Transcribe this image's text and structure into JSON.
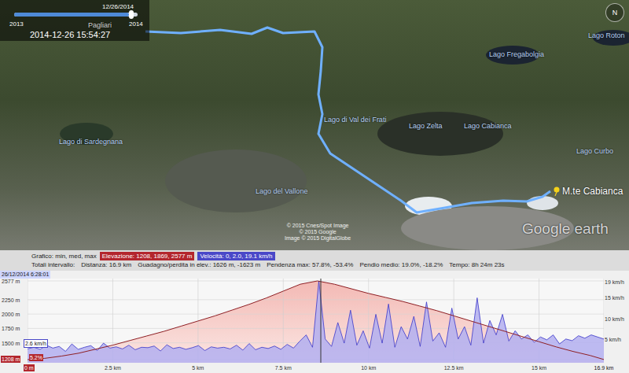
{
  "window": {
    "title": "Google Earth"
  },
  "time_slider": {
    "date": "12/26/2014",
    "start": "2013",
    "end": "2014",
    "level": 0.93,
    "timestamp": "2014-12-26 15:54:27"
  },
  "compass": {
    "label": "N"
  },
  "map": {
    "labels": [
      {
        "text": "Pagliari",
        "kind": "place"
      },
      {
        "text": "Lago Roton",
        "kind": "lake"
      },
      {
        "text": "Lago Fregabolgia",
        "kind": "lake"
      },
      {
        "text": "Lago di Val dei Frati",
        "kind": "lake"
      },
      {
        "text": "Lago Zelta",
        "kind": "lake"
      },
      {
        "text": "Lago Cabianca",
        "kind": "lake"
      },
      {
        "text": "Lago Curbo",
        "kind": "lake"
      },
      {
        "text": "Lago di Sardegnana",
        "kind": "lake"
      },
      {
        "text": "Lago del Vallone",
        "kind": "lake"
      },
      {
        "text": "M.te Cabianca",
        "kind": "peak"
      }
    ],
    "credits": [
      "© 2015 Cnes/Spot Image",
      "© 2015 Google",
      "Image © 2015 DigitalGlobe"
    ],
    "logo": "Google earth"
  },
  "profile_header": {
    "graph": "Grafico: min, med, max",
    "elevation": "Elevazione: 1208, 1869, 2577 m",
    "speed": "Velocità: 0, 2.0, 19.1 km/h",
    "totals": [
      "Totali intervallo:",
      "Distanza: 16.9 km",
      "Guadagno/perdita in elev.: 1626 m, -1623 m",
      "Pendenza max: 57.8%, -53.4%",
      "Pendio medio: 19.0%, -18.2%",
      "Tempo: 8h 24m 23s"
    ]
  },
  "chart": {
    "cursor": {
      "time": "26/12/2014 6:28:01",
      "speed": "2.6 km/h",
      "slope": "5.2%",
      "distance_km": 8.6
    },
    "elevation_ticks": [
      {
        "label": "2577 m",
        "kind": "plain"
      },
      {
        "label": "2250 m",
        "kind": "plain"
      },
      {
        "label": "2000 m",
        "kind": "plain"
      },
      {
        "label": "1750 m",
        "kind": "plain"
      },
      {
        "label": "1500 m",
        "kind": "plain"
      },
      {
        "label": "1208 m",
        "kind": "min"
      }
    ],
    "speed_ticks": [
      "19 km/h",
      "15 km/h",
      "10 km/h",
      "5 km/h"
    ],
    "distance_ticks": [
      {
        "label": "0 m",
        "kind": "start"
      },
      {
        "label": "2.5 km",
        "kind": "plain"
      },
      {
        "label": "5 km",
        "kind": "plain"
      },
      {
        "label": "7.5 km",
        "kind": "plain"
      },
      {
        "label": "10 km",
        "kind": "plain"
      },
      {
        "label": "12.5 km",
        "kind": "plain"
      },
      {
        "label": "15 km",
        "kind": "plain"
      },
      {
        "label": "16.9 km",
        "kind": "end"
      }
    ],
    "elevation": {
      "distance_km": [
        0,
        0.5,
        1,
        1.5,
        2,
        2.5,
        3,
        3.5,
        4,
        4.5,
        5,
        5.5,
        6,
        6.5,
        7,
        7.5,
        8,
        8.5,
        9,
        9.5,
        10,
        10.5,
        11,
        11.5,
        12,
        12.5,
        13,
        13.5,
        14,
        14.5,
        15,
        15.5,
        16,
        16.5,
        16.9
      ],
      "elevation_m": [
        1208,
        1230,
        1270,
        1320,
        1390,
        1460,
        1540,
        1620,
        1700,
        1790,
        1880,
        1970,
        2070,
        2170,
        2280,
        2400,
        2520,
        2577,
        2520,
        2440,
        2360,
        2290,
        2220,
        2140,
        2060,
        1970,
        1880,
        1790,
        1700,
        1610,
        1520,
        1430,
        1350,
        1280,
        1210
      ]
    },
    "speed_kmh": [
      2.6,
      3,
      2.5,
      3.5,
      2.8,
      3.2,
      2,
      3.8,
      2.5,
      3,
      3.4,
      2.2,
      4,
      2.8,
      3.1,
      2.6,
      3.5,
      2.4,
      3,
      2.9,
      3.3,
      2.1,
      3.6,
      2.7,
      3,
      2.5,
      2.9,
      3.4,
      2.2,
      3.1,
      2.8,
      3,
      2.6,
      3.5,
      2.3,
      3.9,
      2.4,
      3,
      2.7,
      3.3,
      2.5,
      3.7,
      2.8,
      4.5,
      6,
      3,
      19.1,
      5,
      3.2,
      9,
      4,
      12,
      3.5,
      7,
      2.8,
      11,
      4,
      13.5,
      3,
      8,
      5,
      10.5,
      3.2,
      14,
      4.5,
      6.5,
      3,
      12.5,
      5,
      8,
      3.5,
      15,
      4,
      9.5,
      6,
      11,
      4.5,
      7,
      5,
      6,
      4.2,
      5.5,
      4.8,
      6,
      3.8,
      5,
      4.6,
      5.8,
      5.2,
      6,
      5.5,
      5
    ]
  }
}
